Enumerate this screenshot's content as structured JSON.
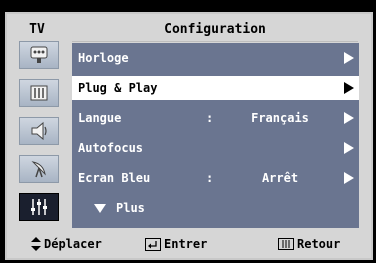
{
  "header": {
    "tv_label": "TV",
    "title": "Configuration"
  },
  "sidebar": {
    "items": [
      {
        "icon": "picture-icon",
        "active": false
      },
      {
        "icon": "sound-icon",
        "active": false
      },
      {
        "icon": "speaker-icon",
        "active": false
      },
      {
        "icon": "antenna-icon",
        "active": false
      },
      {
        "icon": "settings-sliders-icon",
        "active": true
      }
    ]
  },
  "menu": {
    "items": [
      {
        "label": "Horloge",
        "value": "",
        "selected": false
      },
      {
        "label": "Plug & Play",
        "value": "",
        "selected": true
      },
      {
        "label": "Langue",
        "separator": ":",
        "value": "Français",
        "selected": false
      },
      {
        "label": "Autofocus",
        "value": "",
        "selected": false
      },
      {
        "label": "Ecran Bleu",
        "separator": ":",
        "value": "Arrêt",
        "selected": false
      }
    ],
    "more_label": "Plus"
  },
  "footer": {
    "move_label": "Déplacer",
    "enter_label": "Entrer",
    "return_label": "Retour"
  },
  "colors": {
    "panel": "#6a7590",
    "selected_row": "#ffffff",
    "background": "#d6d6d6"
  }
}
